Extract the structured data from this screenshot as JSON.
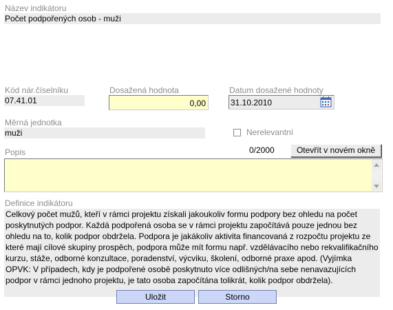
{
  "indicator_name": {
    "label": "Název indikátoru",
    "value": "Počet podpořených osob - muži"
  },
  "code": {
    "label": "Kód nár.číselníku",
    "value": "07.41.01"
  },
  "achieved_value": {
    "label": "Dosažená hodnota",
    "value": "0,00"
  },
  "achieved_date": {
    "label": "Datum dosažené hodnoty",
    "value": "31.10.2010",
    "icon": "calendar-icon"
  },
  "unit": {
    "label": "Měrná jednotka",
    "value": "muži"
  },
  "irrelevant": {
    "label": "Nerelevantní",
    "checked": false
  },
  "description": {
    "label": "Popis",
    "counter": "0/2000",
    "open_button_label": "Otevřít v novém okně",
    "value": ""
  },
  "definition": {
    "label": "Definice indikátoru",
    "text": "Celkový počet mužů, kteří v rámci projektu získali jakoukoliv formu podpory bez ohledu na počet poskytnutých podpor. Každá podpořená osoba se v rámci projektu započítává pouze jednou bez ohledu na to, kolik podpor obdržela. Podpora je jakákoliv aktivita financovaná z rozpočtu projektu ze které mají cílové skupiny prospěch, podpora může mít formu např. vzdělávacího nebo rekvalifikačního kurzu, stáže, odborné konzultace, poradenství, výcviku, školení, odborné praxe apod. (Vyjímka OPVK: V případech, kdy je podpořené osobě poskytnuto více odlišných/na sebe nenavazujících podpor v rámci jednoho projektu, je tato osoba započítána tolikrát, kolik podpor obdržela)."
  },
  "buttons": {
    "save": "Uložit",
    "cancel": "Storno"
  },
  "colors": {
    "readonly_bg": "#ececec",
    "input_bg": "#ffffcc",
    "label": "#8c8c8c",
    "button_bg": "#ccd6f6",
    "button_border": "#6f7fb6"
  }
}
